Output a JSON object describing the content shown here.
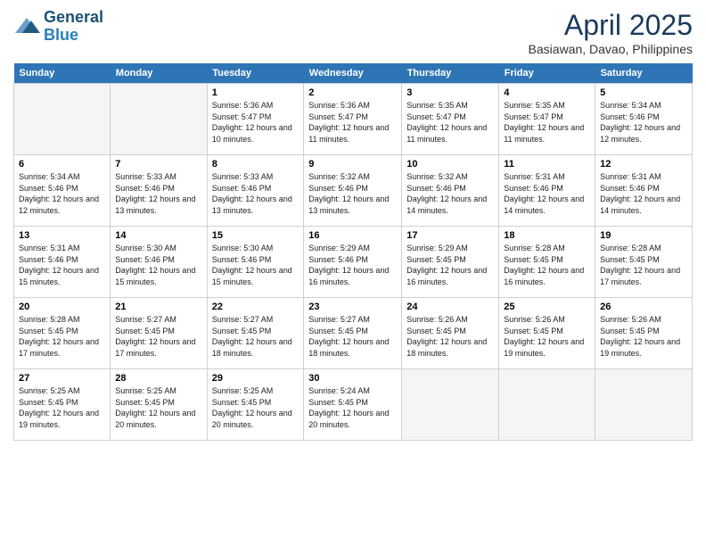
{
  "logo": {
    "line1": "General",
    "line2": "Blue"
  },
  "title": "April 2025",
  "location": "Basiawan, Davao, Philippines",
  "weekdays": [
    "Sunday",
    "Monday",
    "Tuesday",
    "Wednesday",
    "Thursday",
    "Friday",
    "Saturday"
  ],
  "weeks": [
    [
      {
        "day": "",
        "info": ""
      },
      {
        "day": "",
        "info": ""
      },
      {
        "day": "1",
        "info": "Sunrise: 5:36 AM\nSunset: 5:47 PM\nDaylight: 12 hours and 10 minutes."
      },
      {
        "day": "2",
        "info": "Sunrise: 5:36 AM\nSunset: 5:47 PM\nDaylight: 12 hours and 11 minutes."
      },
      {
        "day": "3",
        "info": "Sunrise: 5:35 AM\nSunset: 5:47 PM\nDaylight: 12 hours and 11 minutes."
      },
      {
        "day": "4",
        "info": "Sunrise: 5:35 AM\nSunset: 5:47 PM\nDaylight: 12 hours and 11 minutes."
      },
      {
        "day": "5",
        "info": "Sunrise: 5:34 AM\nSunset: 5:46 PM\nDaylight: 12 hours and 12 minutes."
      }
    ],
    [
      {
        "day": "6",
        "info": "Sunrise: 5:34 AM\nSunset: 5:46 PM\nDaylight: 12 hours and 12 minutes."
      },
      {
        "day": "7",
        "info": "Sunrise: 5:33 AM\nSunset: 5:46 PM\nDaylight: 12 hours and 13 minutes."
      },
      {
        "day": "8",
        "info": "Sunrise: 5:33 AM\nSunset: 5:46 PM\nDaylight: 12 hours and 13 minutes."
      },
      {
        "day": "9",
        "info": "Sunrise: 5:32 AM\nSunset: 5:46 PM\nDaylight: 12 hours and 13 minutes."
      },
      {
        "day": "10",
        "info": "Sunrise: 5:32 AM\nSunset: 5:46 PM\nDaylight: 12 hours and 14 minutes."
      },
      {
        "day": "11",
        "info": "Sunrise: 5:31 AM\nSunset: 5:46 PM\nDaylight: 12 hours and 14 minutes."
      },
      {
        "day": "12",
        "info": "Sunrise: 5:31 AM\nSunset: 5:46 PM\nDaylight: 12 hours and 14 minutes."
      }
    ],
    [
      {
        "day": "13",
        "info": "Sunrise: 5:31 AM\nSunset: 5:46 PM\nDaylight: 12 hours and 15 minutes."
      },
      {
        "day": "14",
        "info": "Sunrise: 5:30 AM\nSunset: 5:46 PM\nDaylight: 12 hours and 15 minutes."
      },
      {
        "day": "15",
        "info": "Sunrise: 5:30 AM\nSunset: 5:46 PM\nDaylight: 12 hours and 15 minutes."
      },
      {
        "day": "16",
        "info": "Sunrise: 5:29 AM\nSunset: 5:46 PM\nDaylight: 12 hours and 16 minutes."
      },
      {
        "day": "17",
        "info": "Sunrise: 5:29 AM\nSunset: 5:45 PM\nDaylight: 12 hours and 16 minutes."
      },
      {
        "day": "18",
        "info": "Sunrise: 5:28 AM\nSunset: 5:45 PM\nDaylight: 12 hours and 16 minutes."
      },
      {
        "day": "19",
        "info": "Sunrise: 5:28 AM\nSunset: 5:45 PM\nDaylight: 12 hours and 17 minutes."
      }
    ],
    [
      {
        "day": "20",
        "info": "Sunrise: 5:28 AM\nSunset: 5:45 PM\nDaylight: 12 hours and 17 minutes."
      },
      {
        "day": "21",
        "info": "Sunrise: 5:27 AM\nSunset: 5:45 PM\nDaylight: 12 hours and 17 minutes."
      },
      {
        "day": "22",
        "info": "Sunrise: 5:27 AM\nSunset: 5:45 PM\nDaylight: 12 hours and 18 minutes."
      },
      {
        "day": "23",
        "info": "Sunrise: 5:27 AM\nSunset: 5:45 PM\nDaylight: 12 hours and 18 minutes."
      },
      {
        "day": "24",
        "info": "Sunrise: 5:26 AM\nSunset: 5:45 PM\nDaylight: 12 hours and 18 minutes."
      },
      {
        "day": "25",
        "info": "Sunrise: 5:26 AM\nSunset: 5:45 PM\nDaylight: 12 hours and 19 minutes."
      },
      {
        "day": "26",
        "info": "Sunrise: 5:26 AM\nSunset: 5:45 PM\nDaylight: 12 hours and 19 minutes."
      }
    ],
    [
      {
        "day": "27",
        "info": "Sunrise: 5:25 AM\nSunset: 5:45 PM\nDaylight: 12 hours and 19 minutes."
      },
      {
        "day": "28",
        "info": "Sunrise: 5:25 AM\nSunset: 5:45 PM\nDaylight: 12 hours and 20 minutes."
      },
      {
        "day": "29",
        "info": "Sunrise: 5:25 AM\nSunset: 5:45 PM\nDaylight: 12 hours and 20 minutes."
      },
      {
        "day": "30",
        "info": "Sunrise: 5:24 AM\nSunset: 5:45 PM\nDaylight: 12 hours and 20 minutes."
      },
      {
        "day": "",
        "info": ""
      },
      {
        "day": "",
        "info": ""
      },
      {
        "day": "",
        "info": ""
      }
    ]
  ]
}
